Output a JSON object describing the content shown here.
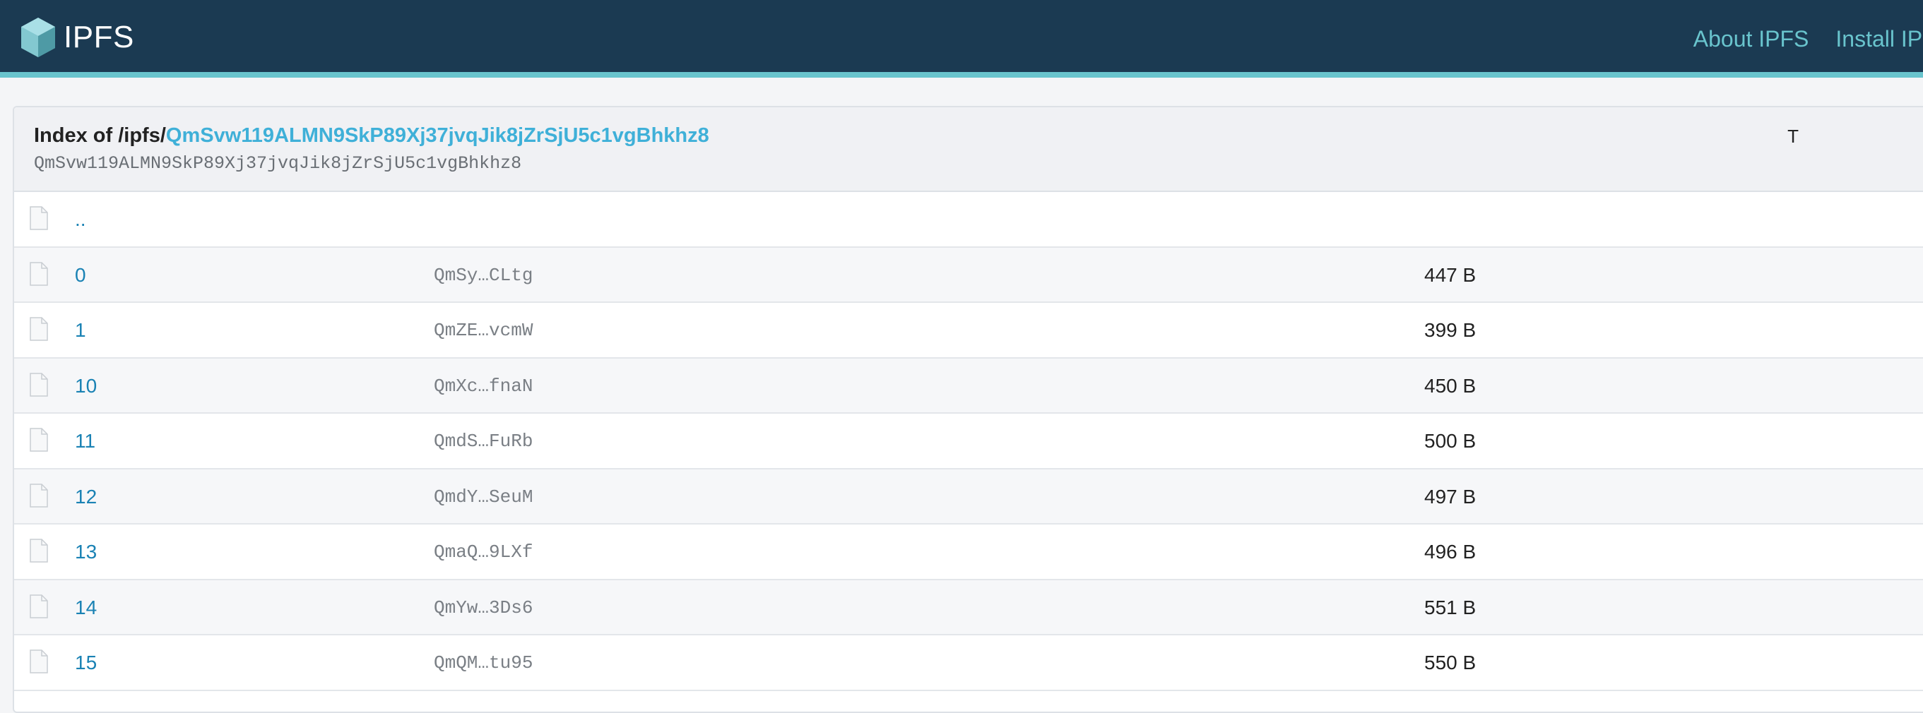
{
  "header": {
    "logo_text": "IPFS",
    "nav": [
      {
        "label": "About IPFS"
      },
      {
        "label": "Install IPFS"
      }
    ]
  },
  "listing": {
    "index_prefix": "Index of /ipfs/",
    "root_cid": "QmSvw119ALMN9SkP89Xj37jvqJik8jZrSjU5c1vgBhkhz8",
    "root_cid_mono": "QmSvw119ALMN9SkP89Xj37jvqJik8jZrSjU5c1vgBhkhz8",
    "head_mark": "T",
    "parent_link": "..",
    "rows": [
      {
        "name": "0",
        "cid": "QmSy…CLtg",
        "size": "447 B"
      },
      {
        "name": "1",
        "cid": "QmZE…vcmW",
        "size": "399 B"
      },
      {
        "name": "10",
        "cid": "QmXc…fnaN",
        "size": "450 B"
      },
      {
        "name": "11",
        "cid": "QmdS…FuRb",
        "size": "500 B"
      },
      {
        "name": "12",
        "cid": "QmdY…SeuM",
        "size": "497 B"
      },
      {
        "name": "13",
        "cid": "QmaQ…9LXf",
        "size": "496 B"
      },
      {
        "name": "14",
        "cid": "QmYw…3Ds6",
        "size": "551 B"
      },
      {
        "name": "15",
        "cid": "QmQM…tu95",
        "size": "550 B"
      }
    ]
  },
  "colors": {
    "header_bg": "#1b3a52",
    "accent": "#69c4cd",
    "link": "#1a82b4",
    "link_light": "#3fb0d8"
  }
}
